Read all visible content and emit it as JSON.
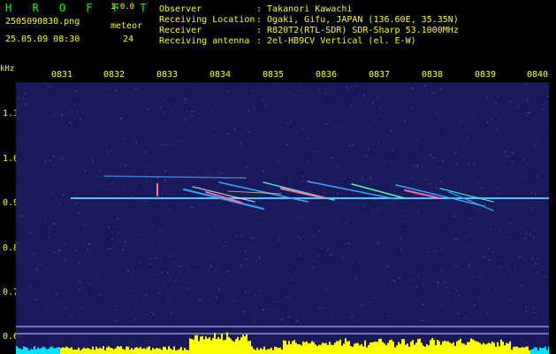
{
  "app": {
    "brand": "H R O F F T",
    "version": "1.0.0",
    "filename": "2505090830.png",
    "datetime": "25.05.09 08:30",
    "meteor_label": "meteor",
    "meteor_count": "24"
  },
  "info": [
    {
      "label": "Observer",
      "value": ": Takanori Kawachi"
    },
    {
      "label": "Receiving Location",
      "value": ": Ogaki, Gifu, JAPAN (136.60E, 35.35N)"
    },
    {
      "label": "Receiver",
      "value": ": R820T2(RTL-SDR) SDR-Sharp 53.1000MHz"
    },
    {
      "label": "Receiving antenna",
      "value": ": 2el-HB9CV Vertical (el. E-W)"
    }
  ],
  "axis": {
    "unit": "kHz",
    "x_ticks": [
      "0831",
      "0832",
      "0833",
      "0834",
      "0835",
      "0836",
      "0837",
      "0838",
      "0839",
      "0840"
    ],
    "y_ticks": [
      "1.1",
      "1.0",
      "0.9",
      "0.8",
      "0.7",
      "0.6"
    ]
  },
  "colors": {
    "text": "#ffff00",
    "brand": "#00ff00",
    "background": "#000000",
    "noise": "#1a1a5c",
    "trace": "#3fb0ff",
    "histogram_fill": "#ffff00",
    "histogram_base": "#00e0ff"
  }
}
